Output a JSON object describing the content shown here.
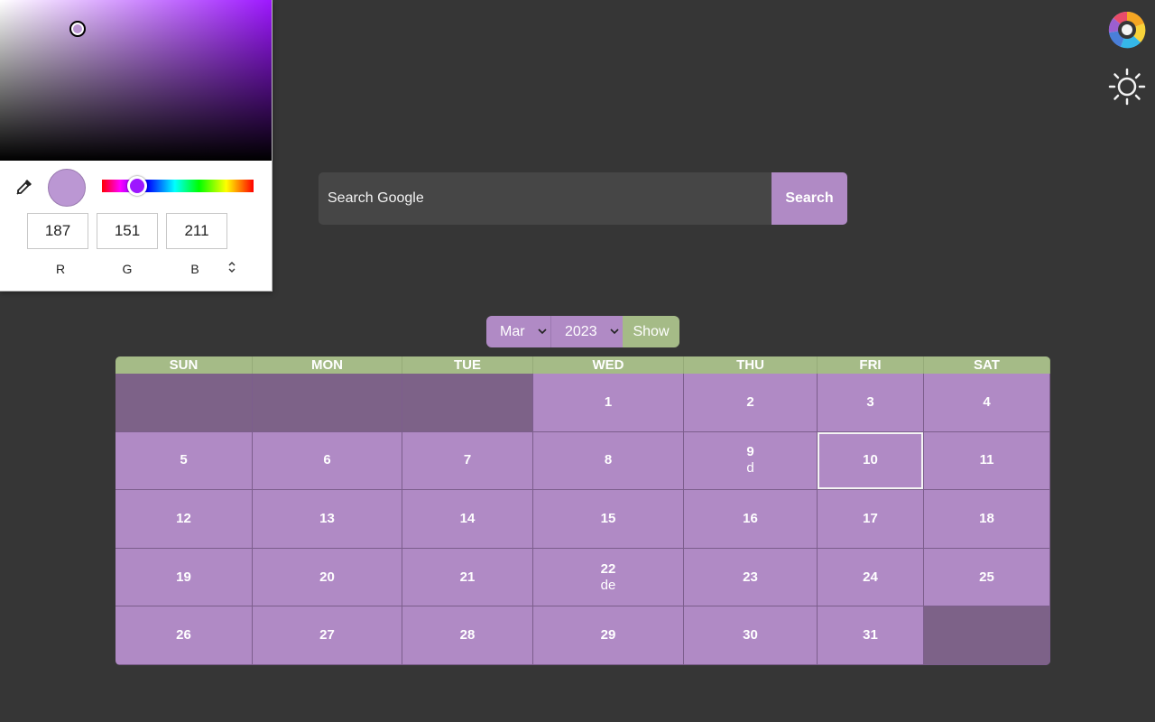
{
  "color_picker": {
    "current_color": "#bb97d3",
    "hue_color": "#9d17ff",
    "rgb": {
      "r": "187",
      "g": "151",
      "b": "211"
    },
    "labels": {
      "r": "R",
      "g": "G",
      "b": "B"
    },
    "mode_toggle_icon": "updown-icon"
  },
  "top_right": {
    "palette_icon": "color-wheel-icon",
    "theme_icon": "sun-icon"
  },
  "search": {
    "placeholder": "Search Google",
    "button_label": "Search"
  },
  "calendar_controls": {
    "month": "Mar",
    "year": "2023",
    "show_label": "Show"
  },
  "calendar": {
    "headers": [
      "SUN",
      "MON",
      "TUE",
      "WED",
      "THU",
      "FRI",
      "SAT"
    ],
    "today": "10",
    "cells": [
      {
        "day": "",
        "note": ""
      },
      {
        "day": "",
        "note": ""
      },
      {
        "day": "",
        "note": ""
      },
      {
        "day": "1",
        "note": ""
      },
      {
        "day": "2",
        "note": ""
      },
      {
        "day": "3",
        "note": ""
      },
      {
        "day": "4",
        "note": ""
      },
      {
        "day": "5",
        "note": ""
      },
      {
        "day": "6",
        "note": ""
      },
      {
        "day": "7",
        "note": ""
      },
      {
        "day": "8",
        "note": ""
      },
      {
        "day": "9",
        "note": "d"
      },
      {
        "day": "10",
        "note": ""
      },
      {
        "day": "11",
        "note": ""
      },
      {
        "day": "12",
        "note": ""
      },
      {
        "day": "13",
        "note": ""
      },
      {
        "day": "14",
        "note": ""
      },
      {
        "day": "15",
        "note": ""
      },
      {
        "day": "16",
        "note": ""
      },
      {
        "day": "17",
        "note": ""
      },
      {
        "day": "18",
        "note": ""
      },
      {
        "day": "19",
        "note": ""
      },
      {
        "day": "20",
        "note": ""
      },
      {
        "day": "21",
        "note": ""
      },
      {
        "day": "22",
        "note": "de"
      },
      {
        "day": "23",
        "note": ""
      },
      {
        "day": "24",
        "note": ""
      },
      {
        "day": "25",
        "note": ""
      },
      {
        "day": "26",
        "note": ""
      },
      {
        "day": "27",
        "note": ""
      },
      {
        "day": "28",
        "note": ""
      },
      {
        "day": "29",
        "note": ""
      },
      {
        "day": "30",
        "note": ""
      },
      {
        "day": "31",
        "note": ""
      },
      {
        "day": "",
        "note": ""
      }
    ]
  },
  "colors": {
    "background": "#363636",
    "accent_purple": "#b08ac5",
    "empty_cell": "#7d6288",
    "accent_green": "#a5bb87",
    "search_field": "#464646"
  }
}
